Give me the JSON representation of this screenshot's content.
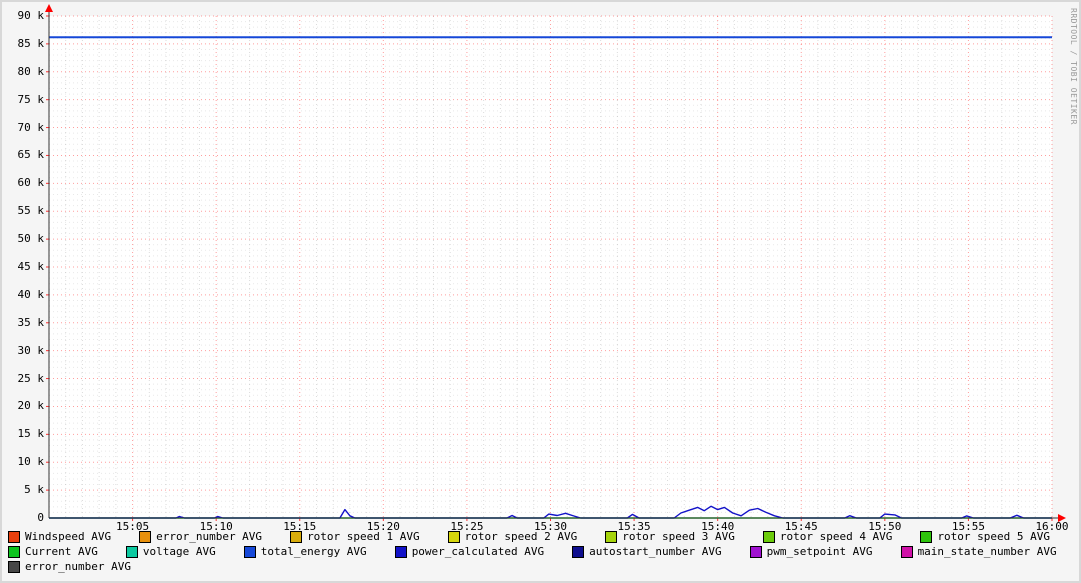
{
  "watermark": "RRDTOOL / TOBI OETIKER",
  "colors": {
    "background": "#F5F5F5",
    "canvas": "#FFFFFF",
    "grid_major": "#FF0000",
    "grid_minor": "#999999",
    "axis": "#333333",
    "arrow": "#FF0000",
    "text": "#000000"
  },
  "chart_data": {
    "type": "line",
    "title": "",
    "xlabel": "",
    "ylabel": "",
    "x_range_minutes": [
      0,
      60
    ],
    "x_start_time": "15:00",
    "x_end_time": "16:00",
    "ylim": [
      0,
      90000
    ],
    "grid": true,
    "legend_position": "bottom",
    "y_ticks": [
      {
        "value": 0,
        "label": "0"
      },
      {
        "value": 5000,
        "label": "5 k"
      },
      {
        "value": 10000,
        "label": "10 k"
      },
      {
        "value": 15000,
        "label": "15 k"
      },
      {
        "value": 20000,
        "label": "20 k"
      },
      {
        "value": 25000,
        "label": "25 k"
      },
      {
        "value": 30000,
        "label": "30 k"
      },
      {
        "value": 35000,
        "label": "35 k"
      },
      {
        "value": 40000,
        "label": "40 k"
      },
      {
        "value": 45000,
        "label": "45 k"
      },
      {
        "value": 50000,
        "label": "50 k"
      },
      {
        "value": 55000,
        "label": "55 k"
      },
      {
        "value": 60000,
        "label": "60 k"
      },
      {
        "value": 65000,
        "label": "65 k"
      },
      {
        "value": 70000,
        "label": "70 k"
      },
      {
        "value": 75000,
        "label": "75 k"
      },
      {
        "value": 80000,
        "label": "80 k"
      },
      {
        "value": 85000,
        "label": "85 k"
      },
      {
        "value": 90000,
        "label": "90 k"
      }
    ],
    "x_ticks": [
      {
        "minute": 5,
        "label": "15:05"
      },
      {
        "minute": 10,
        "label": "15:10"
      },
      {
        "minute": 15,
        "label": "15:15"
      },
      {
        "minute": 20,
        "label": "15:20"
      },
      {
        "minute": 25,
        "label": "15:25"
      },
      {
        "minute": 30,
        "label": "15:30"
      },
      {
        "minute": 35,
        "label": "15:35"
      },
      {
        "minute": 40,
        "label": "15:40"
      },
      {
        "minute": 45,
        "label": "15:45"
      },
      {
        "minute": 50,
        "label": "15:50"
      },
      {
        "minute": 55,
        "label": "15:55"
      },
      {
        "minute": 60,
        "label": "16:00"
      }
    ],
    "series": [
      {
        "name": "Current AVG",
        "color": "#0CC41E",
        "width": 1.4,
        "points": [
          [
            0,
            0
          ],
          [
            60,
            0
          ]
        ]
      },
      {
        "name": "power_calculated AVG",
        "color": "#1212C8",
        "width": 1.4,
        "points": [
          [
            0,
            0
          ],
          [
            7.6,
            0
          ],
          [
            7.8,
            260
          ],
          [
            8.1,
            0
          ],
          [
            9.9,
            0
          ],
          [
            10.1,
            260
          ],
          [
            10.4,
            0
          ],
          [
            17.4,
            0
          ],
          [
            17.7,
            1500
          ],
          [
            18.0,
            400
          ],
          [
            18.3,
            0
          ],
          [
            27.4,
            0
          ],
          [
            27.7,
            450
          ],
          [
            28.0,
            0
          ],
          [
            29.6,
            0
          ],
          [
            29.9,
            700
          ],
          [
            30.4,
            450
          ],
          [
            30.9,
            850
          ],
          [
            31.4,
            350
          ],
          [
            31.8,
            0
          ],
          [
            34.6,
            0
          ],
          [
            34.9,
            650
          ],
          [
            35.3,
            0
          ],
          [
            37.4,
            0
          ],
          [
            37.8,
            900
          ],
          [
            38.3,
            1400
          ],
          [
            38.8,
            1900
          ],
          [
            39.2,
            1300
          ],
          [
            39.6,
            2100
          ],
          [
            40.0,
            1500
          ],
          [
            40.4,
            1900
          ],
          [
            40.9,
            900
          ],
          [
            41.4,
            400
          ],
          [
            41.9,
            1400
          ],
          [
            42.4,
            1700
          ],
          [
            42.9,
            1000
          ],
          [
            43.4,
            400
          ],
          [
            43.9,
            0
          ],
          [
            47.6,
            0
          ],
          [
            47.9,
            420
          ],
          [
            48.3,
            0
          ],
          [
            49.7,
            0
          ],
          [
            50.0,
            700
          ],
          [
            50.6,
            550
          ],
          [
            51.0,
            0
          ],
          [
            54.6,
            0
          ],
          [
            54.9,
            380
          ],
          [
            55.3,
            0
          ],
          [
            57.5,
            0
          ],
          [
            57.9,
            480
          ],
          [
            58.3,
            0
          ],
          [
            60,
            0
          ]
        ]
      },
      {
        "name": "total_energy AVG",
        "color": "#1648D8",
        "width": 2,
        "points": [
          [
            0,
            86200
          ],
          [
            60,
            86200
          ]
        ]
      }
    ]
  },
  "legend_rows": [
    [
      {
        "label": "Windspeed AVG",
        "color": "#E7400E"
      },
      {
        "label": "error_number AVG",
        "color": "#E8900C"
      },
      {
        "label": "rotor speed 1 AVG",
        "color": "#D8AC0C"
      },
      {
        "label": "rotor speed 2 AVG",
        "color": "#D6D60C"
      },
      {
        "label": "rotor speed 3 AVG",
        "color": "#A6D40C"
      },
      {
        "label": "rotor speed 4 AVG",
        "color": "#6CCC0C"
      },
      {
        "label": "rotor speed 5 AVG",
        "color": "#2EC40C"
      }
    ],
    [
      {
        "label": "Current AVG",
        "color": "#0CC41E"
      },
      {
        "label": "voltage AVG",
        "color": "#0CC9A0"
      },
      {
        "label": "total_energy AVG",
        "color": "#1648D8"
      },
      {
        "label": "power_calculated AVG",
        "color": "#1212C8"
      },
      {
        "label": "autostart_number AVG",
        "color": "#0E0E8E"
      },
      {
        "label": "pwm_setpoint AVG",
        "color": "#A012D0"
      },
      {
        "label": "main_state_number AVG",
        "color": "#D012A8"
      }
    ],
    [
      {
        "label": "error_number AVG",
        "color": "#474747"
      }
    ]
  ]
}
